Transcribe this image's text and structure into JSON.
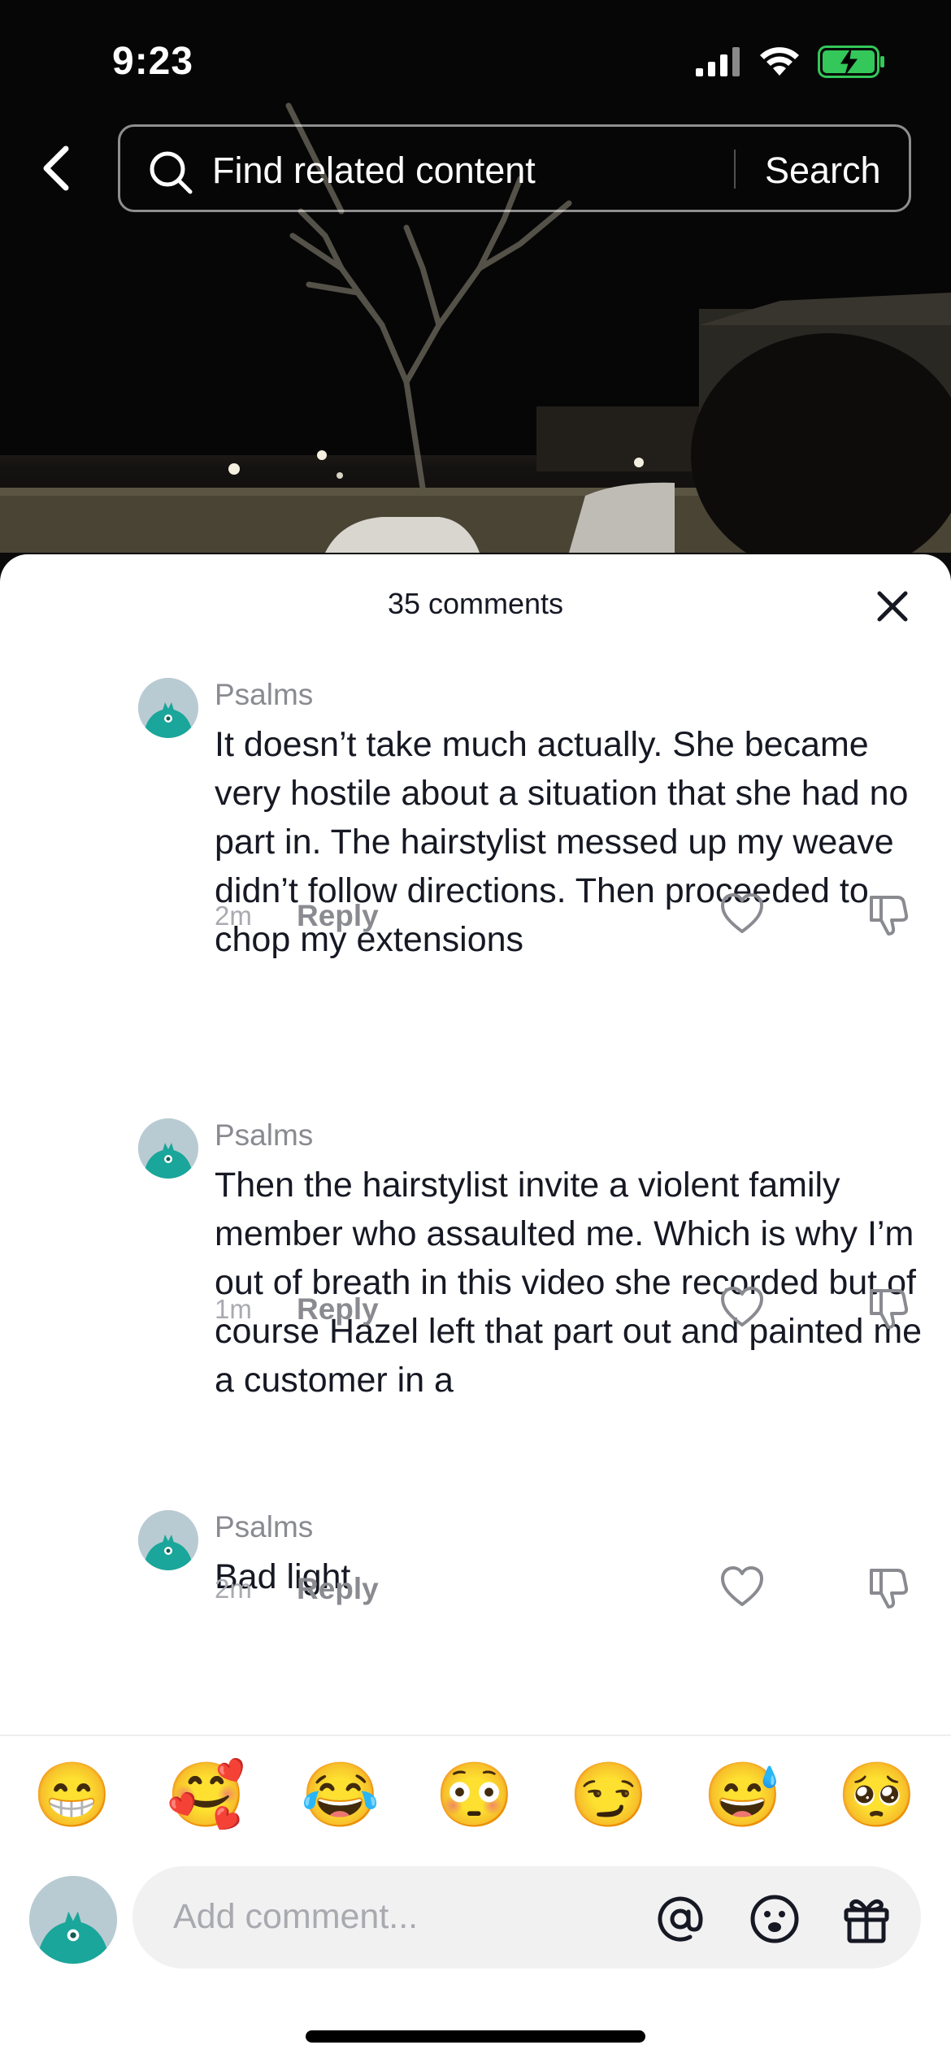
{
  "status_bar": {
    "time": "9:23"
  },
  "search": {
    "placeholder": "Find related content",
    "button_label": "Search"
  },
  "comments_panel": {
    "title": "35 comments",
    "comments": [
      {
        "username": "Psalms",
        "text": "It doesn’t take much actually. She became very hostile about a situation that she had no part in. The hairstylist messed up my weave didn’t follow directions. Then proceeded to chop my extensions",
        "time": "2m",
        "reply_label": "Reply"
      },
      {
        "username": "Psalms",
        "text": "Then the hairstylist invite a violent family member who assaulted me. Which is why I’m out of breath in this video she recorded but of course Hazel left that part out and painted me a customer in a",
        "time": "1m",
        "reply_label": "Reply"
      },
      {
        "username": "Psalms",
        "text": "Bad light",
        "time": "2m",
        "reply_label": "Reply"
      }
    ]
  },
  "emoji_bar": [
    "😁",
    "🥰",
    "😂",
    "😳",
    "😏",
    "😅",
    "🥺"
  ],
  "comment_input": {
    "placeholder": "Add comment..."
  },
  "colors": {
    "avatar_accent": "#1aa69a",
    "battery_green": "#34c759"
  }
}
